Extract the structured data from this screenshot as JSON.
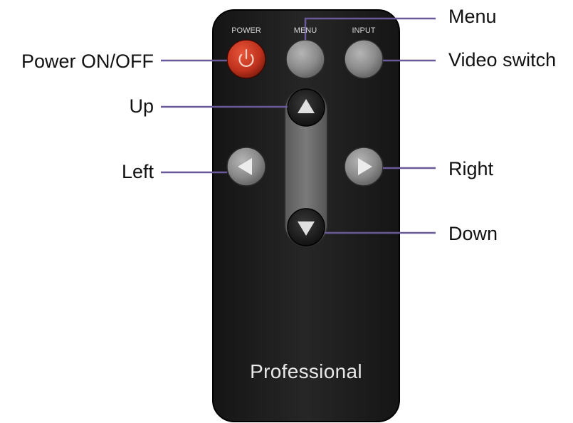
{
  "remote": {
    "power_label": "POWER",
    "menu_label": "MENU",
    "input_label": "INPUT",
    "brand": "Professional"
  },
  "callouts": {
    "menu": "Menu",
    "video_switch": "Video switch",
    "power": "Power ON/OFF",
    "up": "Up",
    "left": "Left",
    "right": "Right",
    "down": "Down"
  },
  "colors": {
    "leader_line": "#6a5a9a",
    "remote_body": "#1e1e1e",
    "power_button": "#c0321e",
    "gray_button": "#8c8c8c"
  }
}
